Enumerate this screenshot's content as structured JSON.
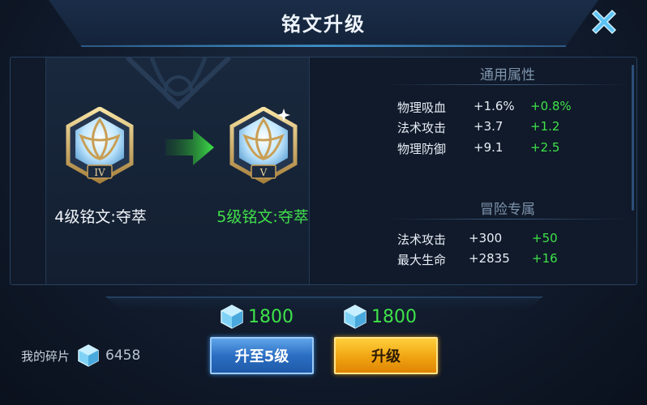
{
  "title": "铭文升级",
  "rune_current": {
    "name": "4级铭文:夺萃",
    "level_numeral": "IV"
  },
  "rune_next": {
    "name": "5级铭文:夺萃",
    "level_numeral": "V"
  },
  "sections": [
    {
      "heading": "通用属性",
      "rows": [
        {
          "name": "物理吸血",
          "base": "+1.6%",
          "inc": "+0.8%"
        },
        {
          "name": "法术攻击",
          "base": "+3.7",
          "inc": "+1.2"
        },
        {
          "name": "物理防御",
          "base": "+9.1",
          "inc": "+2.5"
        }
      ]
    },
    {
      "heading": "冒险专属",
      "rows": [
        {
          "name": "法术攻击",
          "base": "+300",
          "inc": "+50"
        },
        {
          "name": "最大生命",
          "base": "+2835",
          "inc": "+16"
        }
      ]
    }
  ],
  "costs": [
    "1800",
    "1800"
  ],
  "fragments": {
    "label": "我的碎片",
    "value": "6458"
  },
  "buttons": {
    "upgrade_to_5": "升至5级",
    "upgrade": "升级"
  },
  "icons": {
    "close": "close-icon",
    "crystal": "crystal-icon",
    "arrow": "arrow-right-icon"
  },
  "colors": {
    "increase": "#3fe24a",
    "blue_button": "#2b6ec3",
    "gold_button": "#f0a411"
  }
}
